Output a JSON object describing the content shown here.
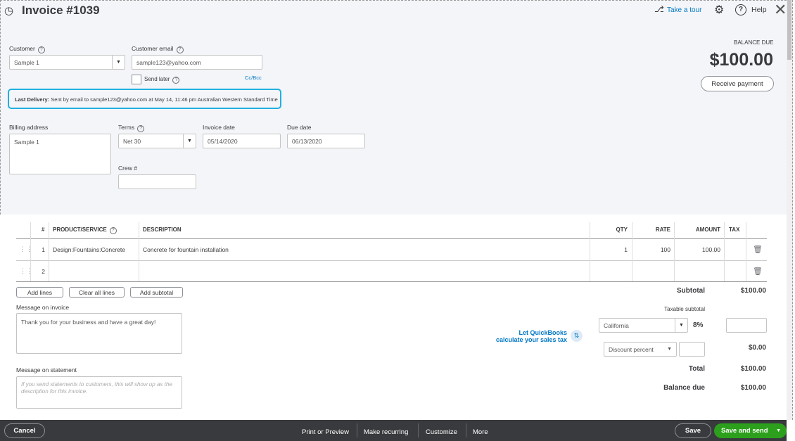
{
  "header": {
    "title": "Invoice #1039",
    "take_tour": "Take a tour",
    "help": "Help"
  },
  "balance": {
    "label": "BALANCE DUE",
    "amount": "$100.00",
    "receive_payment": "Receive payment"
  },
  "customer": {
    "label": "Customer",
    "value": "Sample 1"
  },
  "email": {
    "label": "Customer email",
    "value": "sample123@yahoo.com",
    "send_later": "Send later",
    "cc_bcc": "Cc/Bcc"
  },
  "last_delivery": {
    "label": "Last Delivery:",
    "text": "Sent by email to sample123@yahoo.com at May 14, 11:46 pm Australian Western Standard Time"
  },
  "billing": {
    "label": "Billing address",
    "value": "Sample 1"
  },
  "terms": {
    "label": "Terms",
    "value": "Net 30"
  },
  "invoice_date": {
    "label": "Invoice date",
    "value": "05/14/2020"
  },
  "due_date": {
    "label": "Due date",
    "value": "06/13/2020"
  },
  "crew": {
    "label": "Crew #",
    "value": ""
  },
  "table": {
    "headers": {
      "num": "#",
      "product": "PRODUCT/SERVICE",
      "description": "DESCRIPTION",
      "qty": "QTY",
      "rate": "RATE",
      "amount": "AMOUNT",
      "tax": "TAX"
    },
    "rows": [
      {
        "num": "1",
        "product": "Design:Fountains:Concrete",
        "description": "Concrete for fountain installation",
        "qty": "1",
        "rate": "100",
        "amount": "100.00"
      },
      {
        "num": "2",
        "product": "",
        "description": "",
        "qty": "",
        "rate": "",
        "amount": ""
      }
    ]
  },
  "buttons": {
    "add_lines": "Add lines",
    "clear_all": "Clear all lines",
    "add_subtotal": "Add subtotal"
  },
  "message_invoice": {
    "label": "Message on invoice",
    "value": "Thank you for your business and have a great day!"
  },
  "message_statement": {
    "label": "Message on statement",
    "placeholder": "If you send statements to customers, this will show up as the description for this invoice."
  },
  "totals": {
    "subtotal_label": "Subtotal",
    "subtotal": "$100.00",
    "taxable_label": "Taxable subtotal",
    "tax_region": "California",
    "tax_rate": "8%",
    "qb_tax_line1": "Let QuickBooks",
    "qb_tax_line2": "calculate your sales tax",
    "discount_type": "Discount percent",
    "discount_amount": "$0.00",
    "total_label": "Total",
    "total": "$100.00",
    "balance_due_label": "Balance due",
    "balance_due": "$100.00"
  },
  "footer": {
    "cancel": "Cancel",
    "print_preview": "Print or Preview",
    "make_recurring": "Make recurring",
    "customize": "Customize",
    "more": "More",
    "save": "Save",
    "save_and_send": "Save and send"
  }
}
